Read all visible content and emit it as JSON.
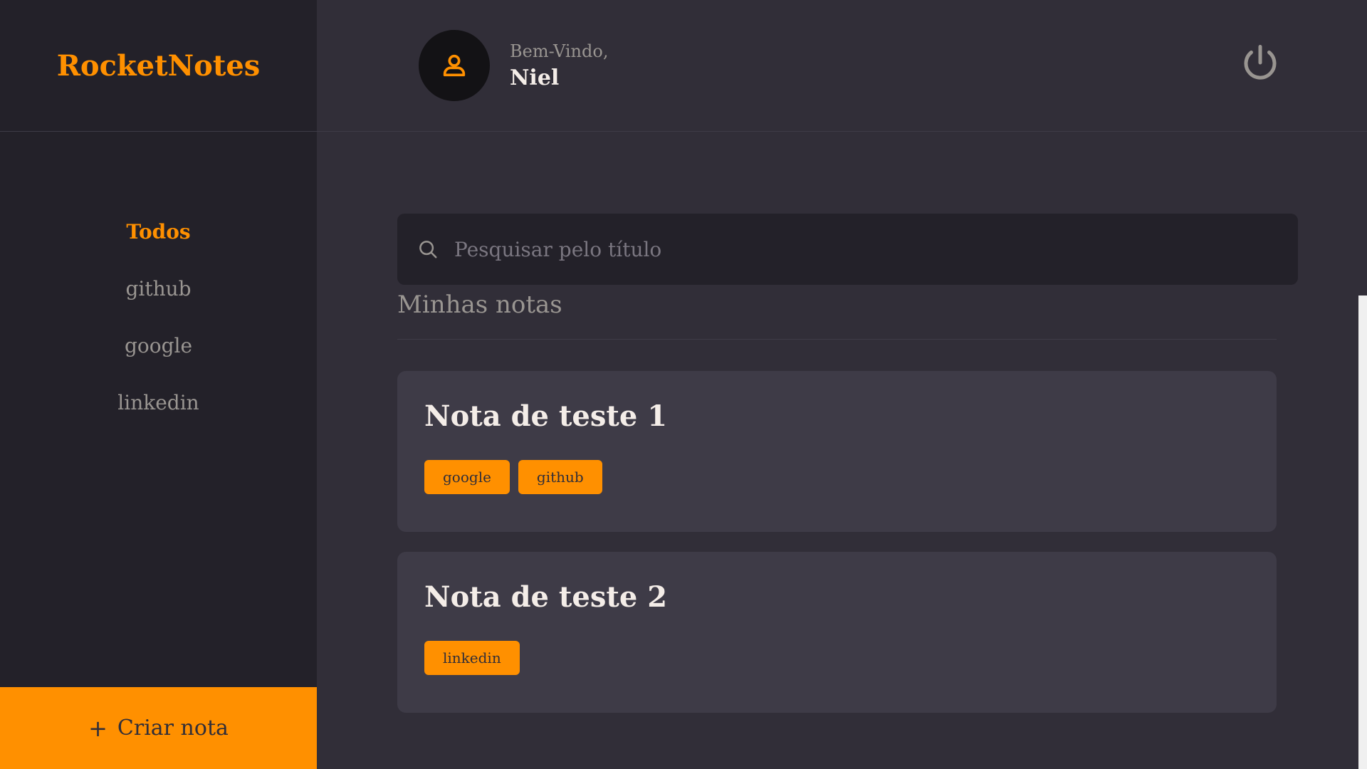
{
  "sidebar": {
    "brand": "RocketNotes",
    "items": [
      {
        "label": "Todos",
        "active": true
      },
      {
        "label": "github",
        "active": false
      },
      {
        "label": "google",
        "active": false
      },
      {
        "label": "linkedin",
        "active": false
      }
    ],
    "new_note_label": "Criar nota",
    "new_note_icon": "plus-icon"
  },
  "header": {
    "welcome_label": "Bem-Vindo,",
    "user_name": "Niel",
    "avatar_icon": "user-icon",
    "logout_icon": "power-icon"
  },
  "search": {
    "placeholder": "Pesquisar pelo título",
    "icon": "search-icon"
  },
  "main": {
    "section_title": "Minhas notas"
  },
  "notes": [
    {
      "title": "Nota de teste 1",
      "tags": [
        "google",
        "github"
      ]
    },
    {
      "title": "Nota de teste 2",
      "tags": [
        "linkedin"
      ]
    }
  ],
  "colors": {
    "accent": "#FF9000",
    "background": "#312E38",
    "sidebar": "#232129",
    "card": "#3E3B47"
  }
}
